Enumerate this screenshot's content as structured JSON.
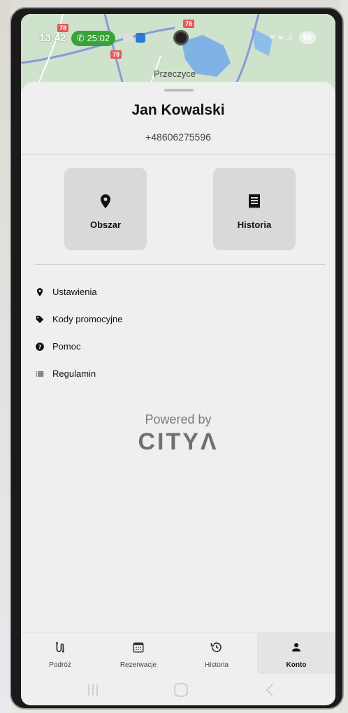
{
  "status_bar": {
    "time": "13:42",
    "call_timer": "25:02",
    "battery": "93"
  },
  "map": {
    "place_label": "Przeczyce",
    "road_numbers": [
      "78",
      "78",
      "78"
    ]
  },
  "profile": {
    "name": "Jan Kowalski",
    "phone": "+48606275596"
  },
  "tiles": [
    {
      "label": "Obszar",
      "icon": "location-pin-icon"
    },
    {
      "label": "Historia",
      "icon": "receipt-icon"
    }
  ],
  "menu": [
    {
      "label": "Ustawienia",
      "icon": "location-pin-icon"
    },
    {
      "label": "Kody promocyjne",
      "icon": "tag-icon"
    },
    {
      "label": "Pomoc",
      "icon": "help-icon"
    },
    {
      "label": "Regulamin",
      "icon": "list-icon"
    }
  ],
  "branding": {
    "powered_by": "Powered by",
    "brand": "CITYΛ"
  },
  "bottom_nav": [
    {
      "label": "Podróż",
      "icon": "route-icon",
      "active": false
    },
    {
      "label": "Rezerwacje",
      "icon": "calendar-icon",
      "active": false
    },
    {
      "label": "Historia",
      "icon": "history-icon",
      "active": false
    },
    {
      "label": "Konto",
      "icon": "person-icon",
      "active": true
    }
  ],
  "colors": {
    "background": "#efefef",
    "tile": "#d9d9d9",
    "text": "#111111",
    "call_pill": "#3aa23a"
  }
}
